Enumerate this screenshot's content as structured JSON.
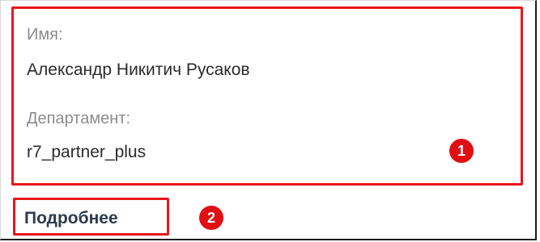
{
  "profile": {
    "name_label": "Имя:",
    "name_value": "Александр Никитич Русаков",
    "department_label": "Департамент:",
    "department_value": "r7_partner_plus"
  },
  "actions": {
    "more_label": "Подробнее"
  },
  "annotations": {
    "marker_1": "1",
    "marker_2": "2",
    "highlight_color": "#e8151c"
  }
}
